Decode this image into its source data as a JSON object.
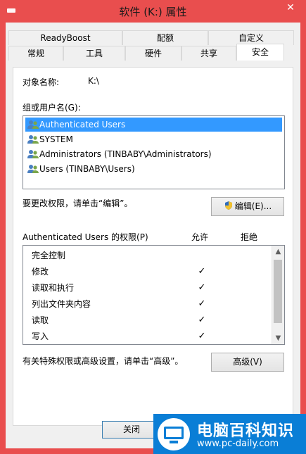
{
  "window": {
    "title": "软件 (K:) 属性",
    "close_glyph": "✕"
  },
  "tabs_back": [
    "ReadyBoost",
    "配额",
    "自定义"
  ],
  "tabs_front": [
    "常规",
    "工具",
    "硬件",
    "共享",
    "安全"
  ],
  "active_tab": "安全",
  "object": {
    "label": "对象名称:",
    "value": "K:\\"
  },
  "groups": {
    "label": "组或用户名(G):",
    "items": [
      "Authenticated Users",
      "SYSTEM",
      "Administrators (TINBABY\\Administrators)",
      "Users (TINBABY\\Users)"
    ],
    "selected_index": 0
  },
  "change_text": "要更改权限，请单击“编辑”。",
  "edit_button": "编辑(E)...",
  "permissions": {
    "label": "Authenticated Users 的权限(P)",
    "allow_header": "允许",
    "deny_header": "拒绝",
    "rows": [
      {
        "name": "完全控制",
        "allow": "",
        "deny": ""
      },
      {
        "name": "修改",
        "allow": "✓",
        "deny": ""
      },
      {
        "name": "读取和执行",
        "allow": "✓",
        "deny": ""
      },
      {
        "name": "列出文件夹内容",
        "allow": "✓",
        "deny": ""
      },
      {
        "name": "读取",
        "allow": "✓",
        "deny": ""
      },
      {
        "name": "写入",
        "allow": "✓",
        "deny": ""
      }
    ]
  },
  "advanced_text": "有关特殊权限或高级设置，请单击“高级”。",
  "advanced_button": "高级(V)",
  "close_button": "关闭",
  "watermark": {
    "name": "电脑百科知识",
    "url": "www.pc-daily.com"
  },
  "colors": {
    "window_frame": "#e94e4e",
    "selection": "#3399ff",
    "brand": "#0a7ed6"
  }
}
